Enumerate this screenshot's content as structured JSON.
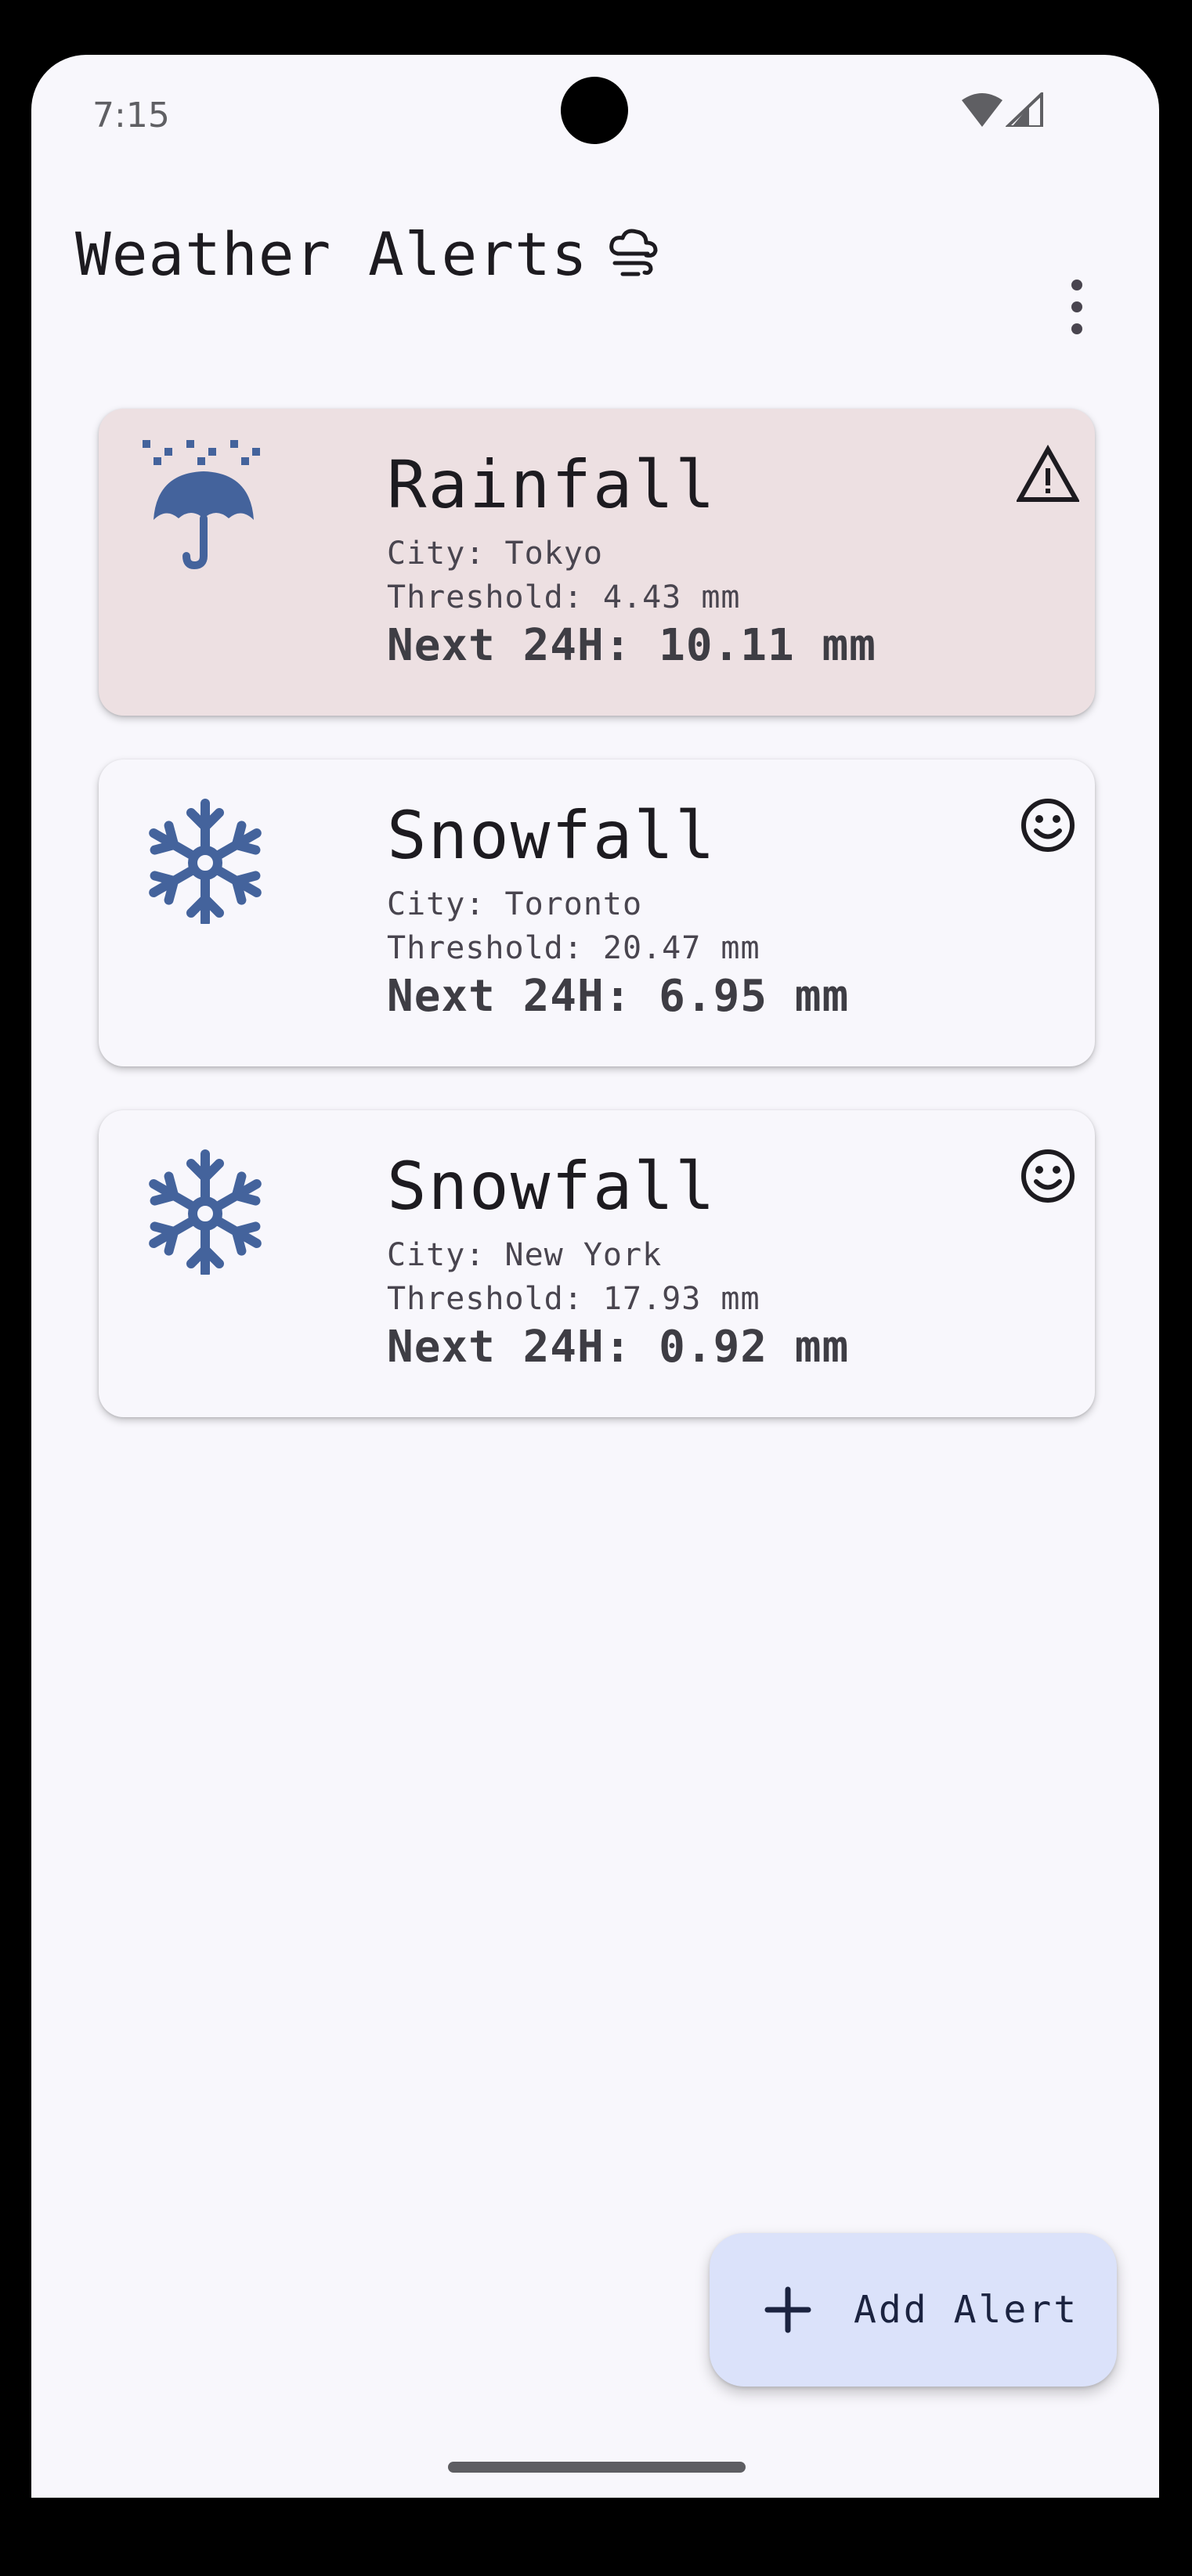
{
  "status_bar": {
    "time": "7:15"
  },
  "app_bar": {
    "title": "Weather Alerts",
    "title_icon": "weather-cloud-icon",
    "menu_icon": "more-vert-icon"
  },
  "alerts": [
    {
      "type": "Rainfall",
      "city": "City: Tokyo",
      "threshold": "Threshold: 4.43 mm",
      "next": "Next 24H: 10.11 mm",
      "icon": "umbrella-rain-icon",
      "status_icon": "warning-icon",
      "triggered": true
    },
    {
      "type": "Snowfall",
      "city": "City: Toronto",
      "threshold": "Threshold: 20.47 mm",
      "next": "Next 24H: 6.95 mm",
      "icon": "snowflake-icon",
      "status_icon": "smiley-icon",
      "triggered": false
    },
    {
      "type": "Snowfall",
      "city": "City: New York",
      "threshold": "Threshold: 17.93 mm",
      "next": "Next 24H: 0.92 mm",
      "icon": "snowflake-icon",
      "status_icon": "smiley-icon",
      "triggered": false
    }
  ],
  "fab": {
    "label": "Add Alert",
    "icon": "plus-icon"
  },
  "colors": {
    "accent_icon": "#44639c",
    "alert_card_bg": "#ede0e2",
    "normal_card_bg": "#f8f7fc",
    "fab_bg": "#dbe2fa",
    "background": "#f8f7fc"
  }
}
